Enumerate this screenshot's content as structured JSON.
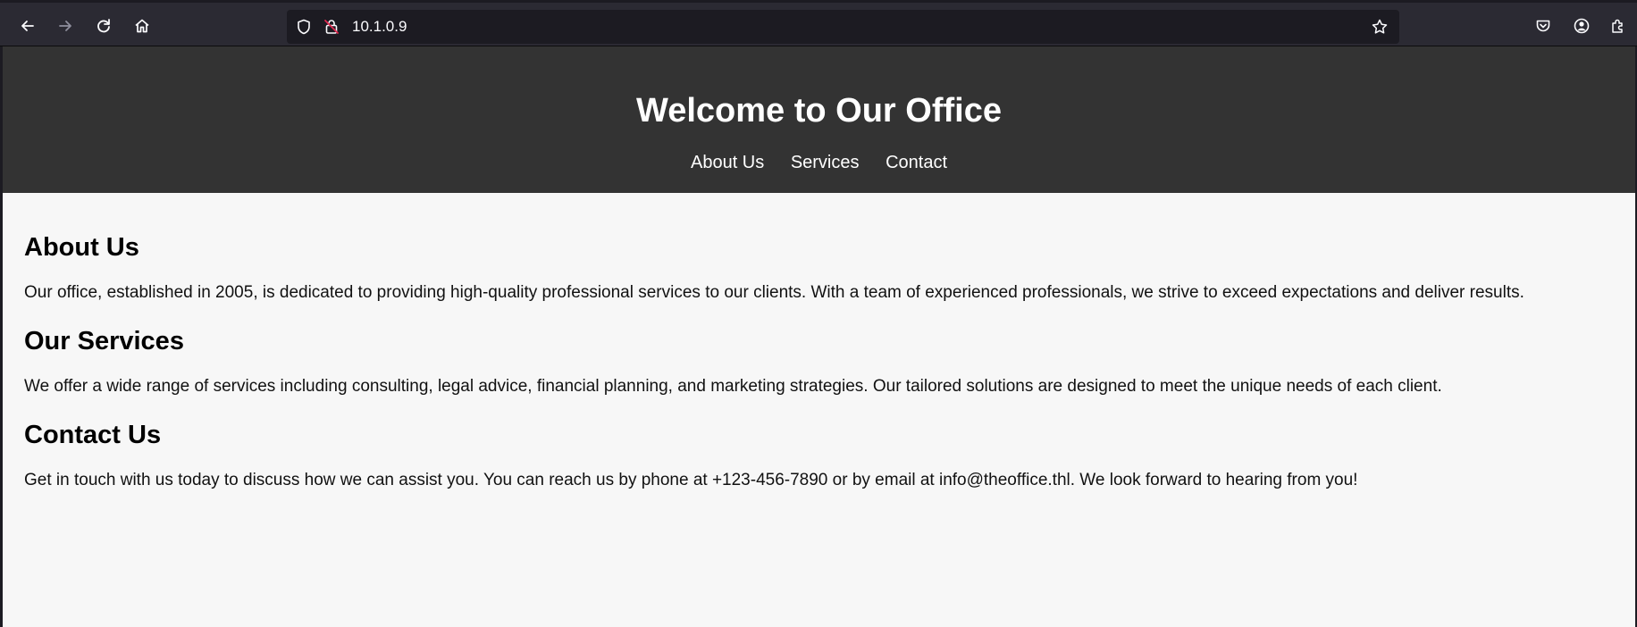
{
  "browser": {
    "url": "10.1.0.9",
    "icons": {
      "back": "arrow-left-icon",
      "forward": "arrow-right-icon",
      "reload": "reload-icon",
      "home": "home-icon",
      "tracking": "shield-icon",
      "insecure": "insecure-lock-icon",
      "bookmark": "star-icon",
      "pocket": "pocket-icon",
      "account": "account-icon",
      "extensions": "extensions-icon"
    },
    "colors": {
      "toolbar": "#2b2a33",
      "urlbar": "#1c1b22",
      "icon": "#fbfbfe",
      "insecure": "#e22850"
    }
  },
  "site": {
    "title": "Welcome to Our Office",
    "nav": [
      {
        "label": "About Us"
      },
      {
        "label": "Services"
      },
      {
        "label": "Contact"
      }
    ],
    "sections": [
      {
        "heading": "About Us",
        "body": "Our office, established in 2005, is dedicated to providing high-quality professional services to our clients. With a team of experienced professionals, we strive to exceed expectations and deliver results."
      },
      {
        "heading": "Our Services",
        "body": "We offer a wide range of services including consulting, legal advice, financial planning, and marketing strategies. Our tailored solutions are designed to meet the unique needs of each client."
      },
      {
        "heading": "Contact Us",
        "body": "Get in touch with us today to discuss how we can assist you. You can reach us by phone at +123-456-7890 or by email at info@theoffice.thl. We look forward to hearing from you!"
      }
    ],
    "colors": {
      "header_bg": "#333333",
      "page_bg": "#f7f7f7",
      "header_text": "#ffffff",
      "body_text": "#000000"
    }
  }
}
